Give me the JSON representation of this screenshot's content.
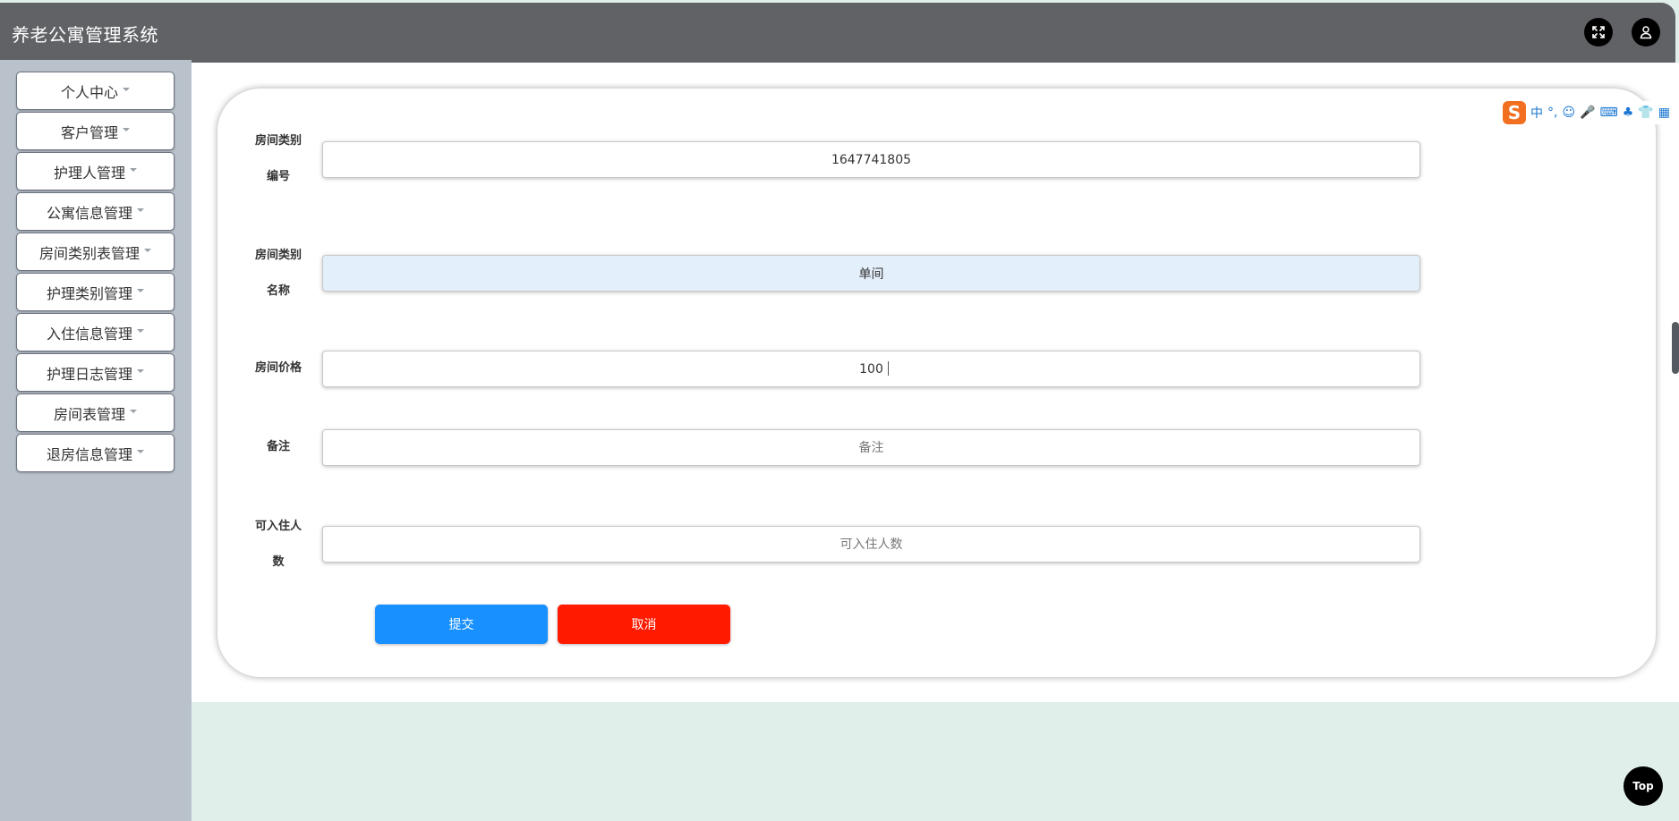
{
  "app": {
    "title": "养老公寓管理系统"
  },
  "header": {
    "fullscreen_icon": "fullscreen-icon",
    "user_icon": "user-icon"
  },
  "sidebar": {
    "items": [
      {
        "label": "个人中心"
      },
      {
        "label": "客户管理"
      },
      {
        "label": "护理人管理"
      },
      {
        "label": "公寓信息管理"
      },
      {
        "label": "房间类别表管理"
      },
      {
        "label": "护理类别管理"
      },
      {
        "label": "入住信息管理"
      },
      {
        "label": "护理日志管理"
      },
      {
        "label": "房间表管理"
      },
      {
        "label": "退房信息管理"
      }
    ]
  },
  "form": {
    "fields": [
      {
        "label_line1": "房间类别",
        "label_line2": "编号",
        "value": "1647741805",
        "placeholder": ""
      },
      {
        "label_line1": "房间类别",
        "label_line2": "名称",
        "value": "单间",
        "placeholder": ""
      },
      {
        "label": "房间价格",
        "value": "100",
        "placeholder": ""
      },
      {
        "label": "备注",
        "value": "",
        "placeholder": "备注"
      },
      {
        "label_line1": "可入住人",
        "label_line2": "数",
        "value": "",
        "placeholder": "可入住人数"
      }
    ],
    "submit_label": "提交",
    "cancel_label": "取消"
  },
  "ime": {
    "logo": "S",
    "items": [
      "中",
      "°,",
      "☺",
      "🎤",
      "⌨",
      "♣",
      "👕",
      "▦"
    ]
  },
  "top_button": {
    "label": "Top"
  },
  "colors": {
    "header": "#606266",
    "sidebar": "#b9c2cb",
    "submit": "#1890ff",
    "cancel": "#ff1a00",
    "content_bg": "#e1efea"
  }
}
